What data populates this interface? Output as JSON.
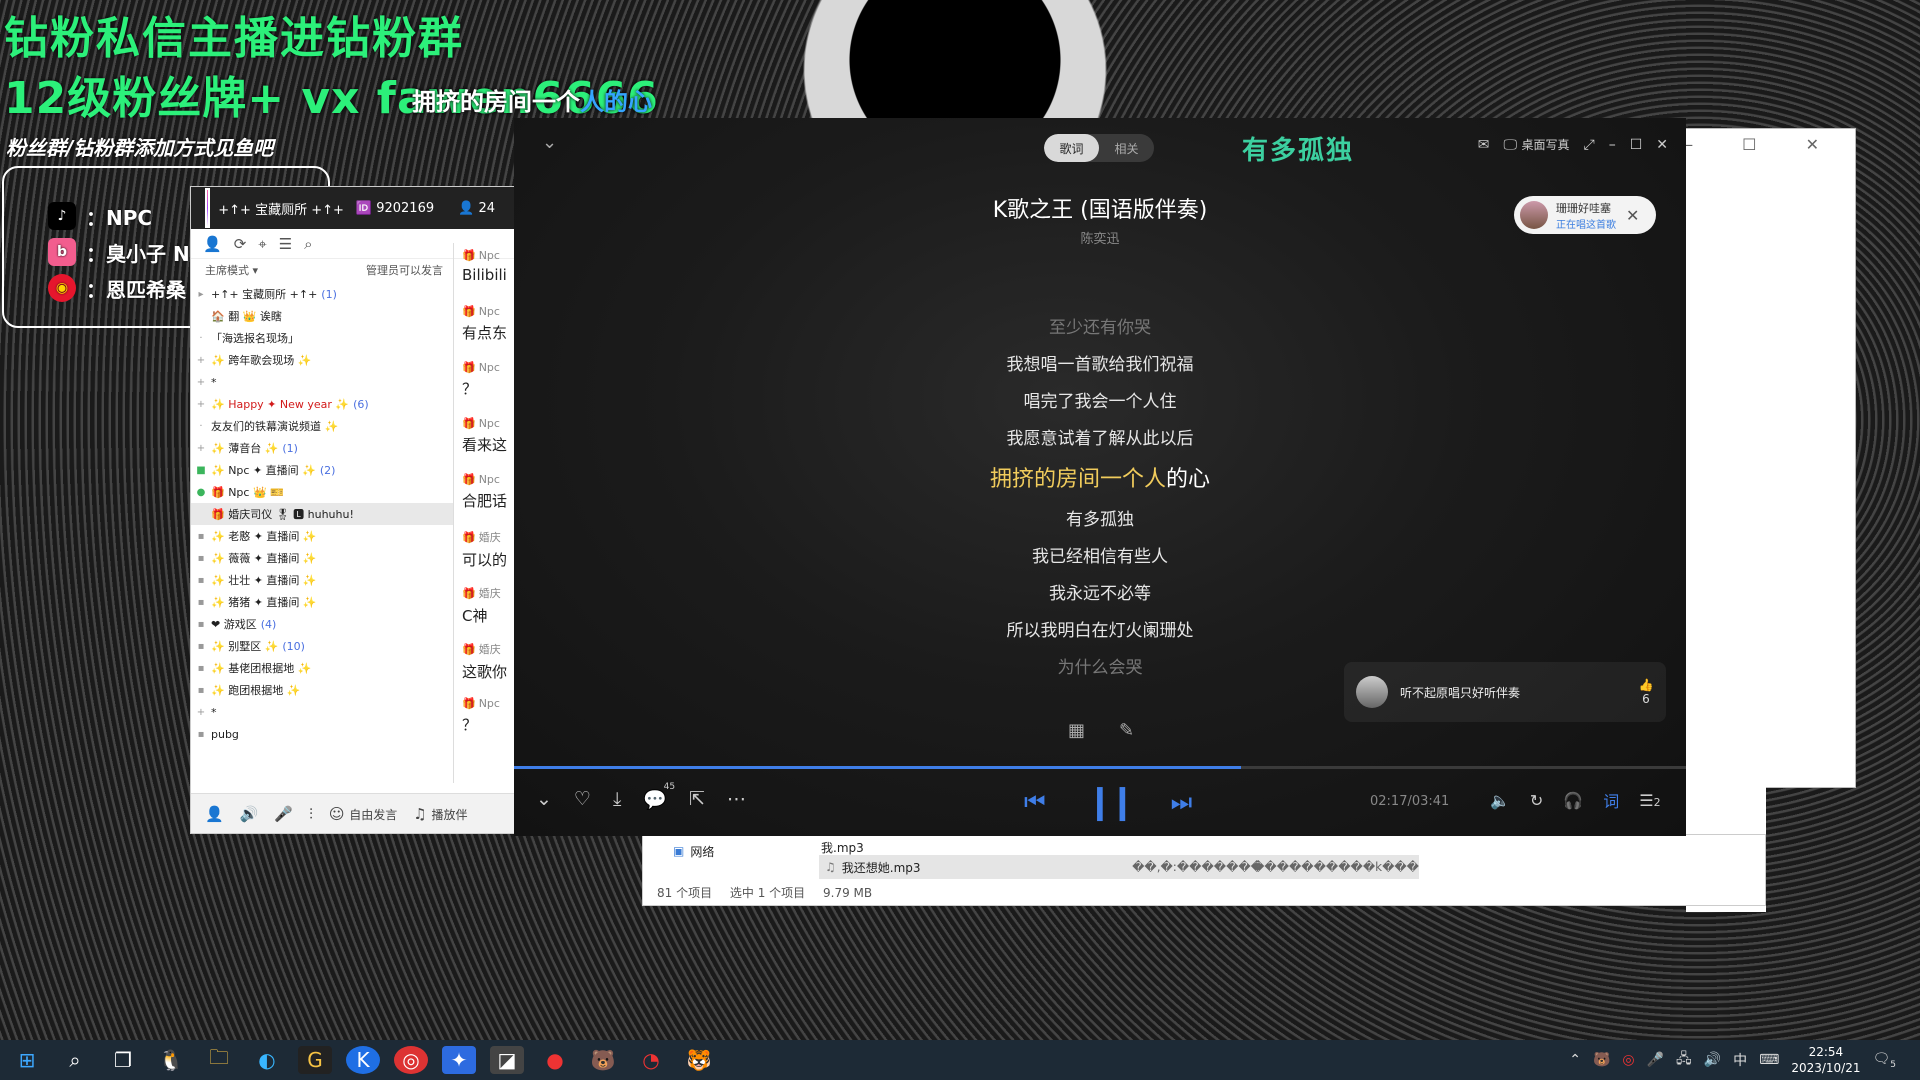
{
  "overlay": {
    "line1": "钻粉私信主播进钻粉群",
    "line2": "12级粉丝牌+ vx fawen6666",
    "lyric_pre": "拥挤的房间一个",
    "lyric_hl": "人的心",
    "line3": "粉丝群/钻粉群添加方式见鱼吧",
    "social": [
      {
        "icon": "tiktok-icon",
        "glyph": "♪",
        "label": "：NPC"
      },
      {
        "icon": "bilibili-icon",
        "glyph": "b",
        "label": "：臭小子 NPC"
      },
      {
        "icon": "weibo-icon",
        "glyph": "◉",
        "label": "：恩匹希桑"
      }
    ]
  },
  "yy": {
    "channel_name": "+↑+ 宝藏厕所 +↑+",
    "channel_id": "9202169",
    "users": "24",
    "mode": "主席模式 ▾",
    "mode_note": "管理员可以发言",
    "tree": [
      {
        "exp": "▸",
        "text": "+↑+ 宝藏厕所 +↑+",
        "cnt": "(1)"
      },
      {
        "exp": "",
        "text": "   🏠 翻 👑 诶瞎",
        "cnt": ""
      },
      {
        "exp": "·",
        "text": "「海选报名现场」",
        "cnt": ""
      },
      {
        "exp": "+",
        "text": "✨  跨年歌会现场  ✨",
        "cnt": ""
      },
      {
        "exp": "+",
        "text": "                    *",
        "cnt": ""
      },
      {
        "exp": "+",
        "text": "✨ Happy ✦ New year ✨",
        "cnt": "(6)",
        "red": true
      },
      {
        "exp": "·",
        "text": "友友们的铁幕演说频道 ✨",
        "cnt": ""
      },
      {
        "exp": "+",
        "text": "✨      薄音台     ✨",
        "cnt": "(1)"
      },
      {
        "exp": "■",
        "text": "✨  Npc ✦ 直播间  ✨",
        "cnt": "(2)"
      },
      {
        "exp": "●",
        "text": "🎁 Npc 👑 🎫",
        "cnt": ""
      },
      {
        "exp": "",
        "text": "🎁 婚庆司仪 🎖 🅻 huhuhu!",
        "cnt": "",
        "sel": true
      },
      {
        "exp": "▪",
        "text": "✨  老憨 ✦ 直播间  ✨",
        "cnt": ""
      },
      {
        "exp": "▪",
        "text": "✨  薇薇 ✦ 直播间  ✨",
        "cnt": ""
      },
      {
        "exp": "▪",
        "text": "✨  壮壮 ✦ 直播间  ✨",
        "cnt": ""
      },
      {
        "exp": "▪",
        "text": "✨  猪猪 ✦ 直播间  ✨",
        "cnt": ""
      },
      {
        "exp": "▪",
        "text": "❤      游戏区",
        "cnt": "(4)"
      },
      {
        "exp": "▪",
        "text": "✨      别墅区     ✨",
        "cnt": "(10)"
      },
      {
        "exp": "▪",
        "text": "✨    基佬团根据地   ✨",
        "cnt": ""
      },
      {
        "exp": "▪",
        "text": "✨    跑团根据地   ✨",
        "cnt": ""
      },
      {
        "exp": "+",
        "text": "                         *",
        "cnt": ""
      },
      {
        "exp": "▪",
        "text": "pubg",
        "cnt": ""
      }
    ],
    "chat": [
      {
        "name": "Npc",
        "msg": "Bilibili"
      },
      {
        "name": "Npc",
        "msg": "有点东"
      },
      {
        "name": "Npc",
        "msg": "？"
      },
      {
        "name": "Npc",
        "msg": "看来这"
      },
      {
        "name": "Npc",
        "msg": "合肥话"
      },
      {
        "name": "婚庆",
        "msg": "可以的"
      },
      {
        "name": "婚庆",
        "msg": "C神"
      },
      {
        "name": "婚庆",
        "msg": "这歌你"
      },
      {
        "name": "Npc",
        "msg": "？"
      }
    ],
    "footer_free": "自由发言",
    "footer_play": "播放伴"
  },
  "explorer": {
    "nav_item": "网络",
    "file_above": "我.mp3",
    "file_selected": "我还想她.mp3",
    "garbled1": "��,�:�������",
    "garbled2": "����������k���",
    "status_items": "81 个项目",
    "status_selected": "选中 1 个项目",
    "status_size": "9.79 MB"
  },
  "player": {
    "tab_lyrics": "歌词",
    "tab_related": "相关",
    "top_title": "有多孤独",
    "desktop_lyrics": "桌面写真",
    "song_title": "K歌之王 (国语版伴奏)",
    "artist": "陈奕迅",
    "ad_name": "珊珊好哇塞",
    "ad_status": "正在唱这首歌",
    "lyrics_before": [
      "至少还有你哭",
      "我想唱一首歌给我们祝福",
      "唱完了我会一个人住",
      "我愿意试着了解从此以后"
    ],
    "current_done": "拥挤的房间一个人",
    "current_rest": "的心",
    "lyrics_after": [
      "有多孤独",
      "我已经相信有些人",
      "我永远不必等",
      "所以我明白在灯火阑珊处",
      "为什么会哭"
    ],
    "related_text": "听不起原唱只好听伴奏",
    "related_likes": "6",
    "time": "02:17/03:41",
    "progress": 0.62,
    "queue_count": "2",
    "lyric_toggle": "词",
    "comment_count": "45"
  },
  "taskbar": {
    "time": "22:54",
    "date": "2023/10/21",
    "ime": "中",
    "notif_count": "5"
  }
}
